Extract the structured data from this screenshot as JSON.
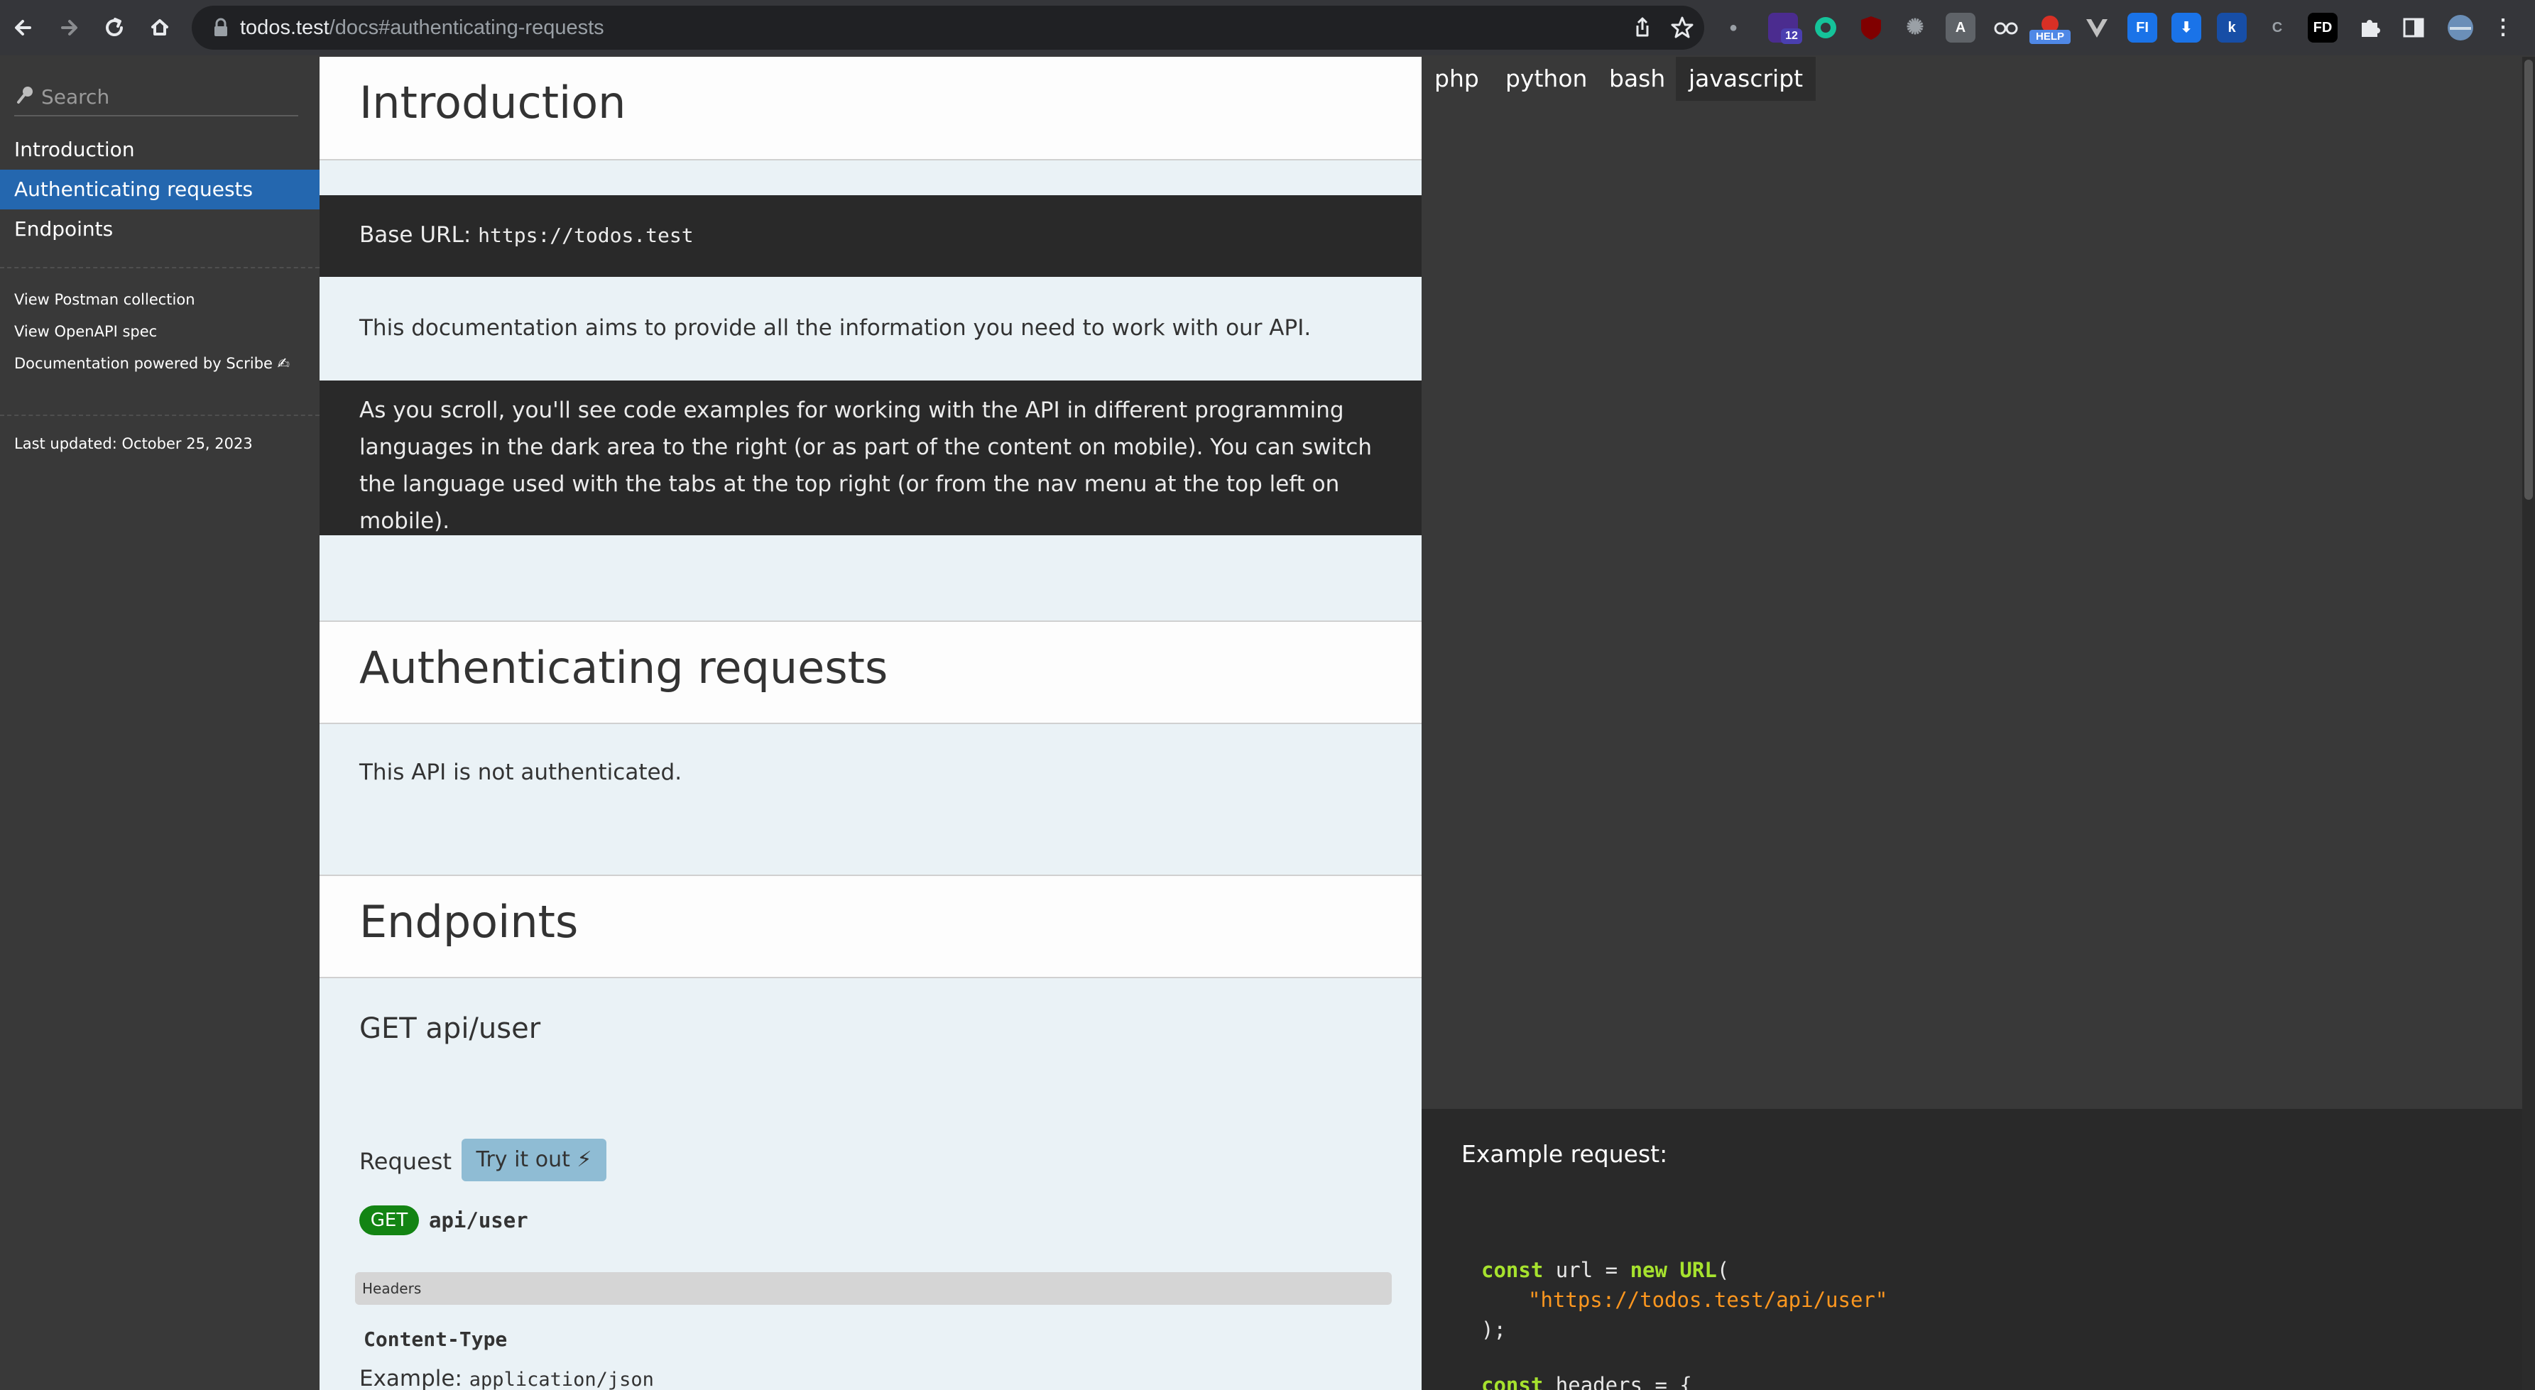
{
  "browser": {
    "url_host": "todos.test",
    "url_path": "/docs#authenticating-requests",
    "extension_badge": "12",
    "help_badge": "HELP",
    "ext_fd": "FD"
  },
  "sidebar": {
    "search_placeholder": "Search",
    "toc": [
      {
        "label": "Introduction",
        "active": false
      },
      {
        "label": "Authenticating requests",
        "active": true
      },
      {
        "label": "Endpoints",
        "active": false
      }
    ],
    "links": [
      {
        "label": "View Postman collection"
      },
      {
        "label": "View OpenAPI spec"
      },
      {
        "label": "Documentation powered by Scribe ✍"
      }
    ],
    "last_updated": "Last updated: October 25, 2023"
  },
  "content": {
    "intro_title": "Introduction",
    "base_url_label": "Base URL:",
    "base_url_value": "https://todos.test",
    "intro_para": "This documentation aims to provide all the information you need to work with our API.",
    "scroll_para": "As you scroll, you'll see code examples for working with the API in different programming languages in the dark area to the right (or as part of the content on mobile). You can switch the language used with the tabs at the top right (or from the nav menu at the top left on mobile).",
    "auth_title": "Authenticating requests",
    "auth_para": "This API is not authenticated.",
    "endpoints_title": "Endpoints",
    "endpoint_heading": "GET api/user",
    "request_label": "Request",
    "try_button": "Try it out ⚡",
    "method_badge": "GET",
    "route": "api/user",
    "headers_label": "Headers",
    "header_name": "Content-Type",
    "example_label": "Example:",
    "example_value": "application/json"
  },
  "code_pane": {
    "tabs": [
      {
        "label": "php",
        "active": false
      },
      {
        "label": "python",
        "active": false
      },
      {
        "label": "bash",
        "active": false
      },
      {
        "label": "javascript",
        "active": true
      }
    ],
    "example_title": "Example request:",
    "code_kw_const": "const",
    "code_var_url": "url",
    "code_eq_new": "= ",
    "code_kw_new": "new",
    "code_kw_URL": "URL",
    "code_paren_open": "(",
    "code_string": "\"https://todos.test/api/user\"",
    "code_close": ");",
    "code_var_headers": "headers = {"
  },
  "colors": {
    "sidebar_bg": "#393939",
    "active_toc": "#2467af",
    "content_bg": "#eaf2f6",
    "dark_block": "#292929",
    "get_badge": "#138413",
    "try_button": "#8fbcd4"
  }
}
